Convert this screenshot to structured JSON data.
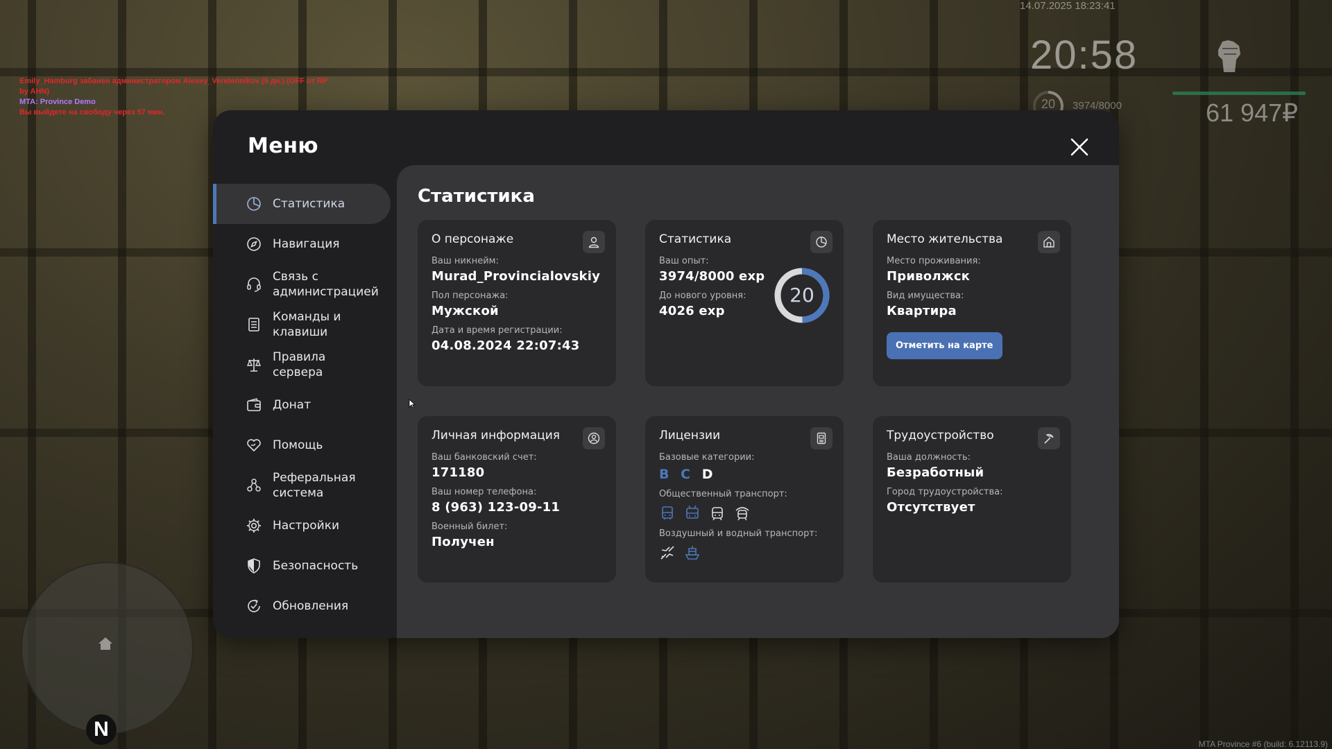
{
  "hud": {
    "chat": [
      {
        "text": "Emily_Hamburg забанен администратором Alexey_Veretennikov (5 дн.) (OFF от RP",
        "color": "#e02828"
      },
      {
        "text": " by AHN)",
        "color": "#e02828"
      },
      {
        "text": "MTA: Province Demo",
        "color": "#b07bff"
      },
      {
        "text": "Вы выйдете на свободу через 57 мин.",
        "color": "#e02828"
      }
    ],
    "datetime": "14.07.2025 18:23:41",
    "clock": "20:58",
    "level": "20",
    "exp": "3974/8000",
    "money": "61 947₽",
    "compass": "N",
    "build": "MTA Province #6 (build: 6.12113.9)"
  },
  "menu": {
    "title": "Меню",
    "sidebar": [
      {
        "label": "Статистика",
        "icon": "statistics-icon",
        "active": true
      },
      {
        "label": "Навигация",
        "icon": "compass-icon"
      },
      {
        "label": "Связь с администрацией",
        "icon": "headset-icon"
      },
      {
        "label": "Команды и клавиши",
        "icon": "document-list-icon"
      },
      {
        "label": "Правила сервера",
        "icon": "scales-icon"
      },
      {
        "label": "Донат",
        "icon": "wallet-icon"
      },
      {
        "label": "Помощь",
        "icon": "heart-hand-icon"
      },
      {
        "label": "Реферальная система",
        "icon": "people-network-icon"
      },
      {
        "label": "Настройки",
        "icon": "gear-icon"
      },
      {
        "label": "Безопасность",
        "icon": "shield-icon"
      },
      {
        "label": "Обновления",
        "icon": "refresh-check-icon"
      }
    ]
  },
  "stats": {
    "title": "Статистика",
    "character": {
      "title": "О персонаже",
      "nick_label": "Ваш никнейм:",
      "nick": "Murad_Provincialovskiy",
      "gender_label": "Пол персонажа:",
      "gender": "Мужской",
      "reg_label": "Дата и время регистрации:",
      "reg": "04.08.2024 22:07:43"
    },
    "experience": {
      "title": "Статистика",
      "exp_label": "Ваш опыт:",
      "exp": "3974/8000 exp",
      "next_label": "До нового уровня:",
      "next": "4026 exp",
      "level": "20",
      "progress": 0.4967
    },
    "residence": {
      "title": "Место жительства",
      "place_label": "Место проживания:",
      "place": "Приволжск",
      "type_label": "Вид имущества:",
      "type": "Квартира",
      "button": "Отметить на карте"
    },
    "personal": {
      "title": "Личная информация",
      "bank_label": "Ваш банковский счет:",
      "bank": "171180",
      "phone_label": "Ваш номер телефона:",
      "phone": "8 (963) 123-09-11",
      "military_label": "Военный билет:",
      "military": "Получен"
    },
    "licenses": {
      "title": "Лицензии",
      "base_label": "Базовые категории:",
      "categories": [
        {
          "letter": "B",
          "color": "#4d78ba"
        },
        {
          "letter": "C",
          "color": "#4d78ba"
        },
        {
          "letter": "D",
          "color": "#ffffff"
        }
      ],
      "public_label": "Общественный транспорт:",
      "air_label": "Воздушный и водный транспорт:"
    },
    "job": {
      "title": "Трудоустройство",
      "position_label": "Ваша должность:",
      "position": "Безработный",
      "city_label": "Город трудоустройства:",
      "city": "Отсутствует"
    }
  }
}
